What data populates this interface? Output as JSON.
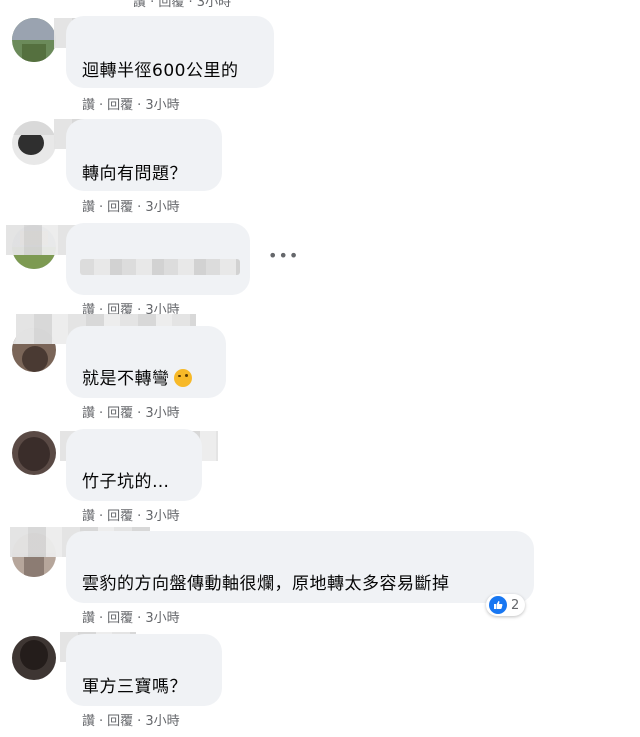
{
  "top_actions": "讚 · 回覆 · 3小時",
  "action_labels": {
    "like": "讚",
    "reply": "回覆",
    "dot": "·"
  },
  "comments": [
    {
      "text": "迴轉半徑600公里的",
      "time": "3小時"
    },
    {
      "text": "轉向有問題？",
      "time": "3小時"
    },
    {
      "text": "",
      "time": "3小時"
    },
    {
      "text": "就是不轉彎",
      "time": "3小時",
      "emoji": "wink-emoji"
    },
    {
      "text": "竹子坑的…",
      "time": "3小時"
    },
    {
      "text": "雲豹的方向盤傳動軸很爛，原地轉太多容易斷掉",
      "time": "3小時",
      "reaction_count": "2"
    },
    {
      "text": "軍方三寶嗎？",
      "time": "3小時"
    }
  ],
  "more_icon": "•••",
  "colors": {
    "bubble": "#f0f2f5",
    "meta": "#65676b",
    "like": "#1877f2"
  }
}
